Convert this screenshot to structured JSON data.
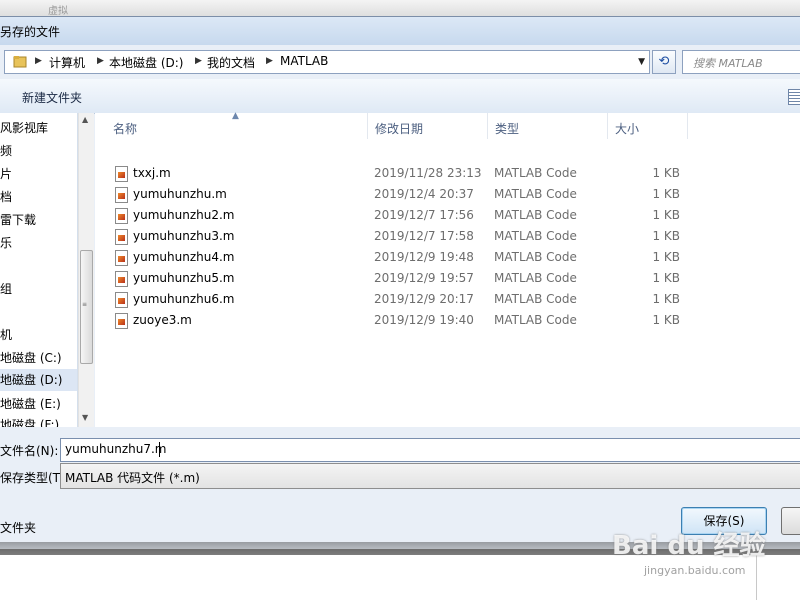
{
  "background": {
    "ghost_tab": "虚拟"
  },
  "dialog": {
    "title": "另存的文件",
    "address": {
      "crumbs": [
        "计算机",
        "本地磁盘 (D:)",
        "我的文档",
        "MATLAB"
      ]
    },
    "search_placeholder": "搜索 MATLAB",
    "toolbar": {
      "new_folder": "新建文件夹"
    },
    "nav": {
      "items": [
        "风影视库",
        "频",
        "片",
        "档",
        "雷下载",
        "乐",
        "组",
        "机",
        "地磁盘 (C:)",
        "地磁盘 (D:)",
        "地磁盘 (E:)",
        "地磁盘 (F:)"
      ],
      "selected_index": 9
    },
    "columns": {
      "name": "名称",
      "date": "修改日期",
      "type": "类型",
      "size": "大小"
    },
    "files": [
      {
        "name": "txxj.m",
        "date": "2019/11/28 23:13",
        "type": "MATLAB Code",
        "size": "1 KB"
      },
      {
        "name": "yumuhunzhu.m",
        "date": "2019/12/4 20:37",
        "type": "MATLAB Code",
        "size": "1 KB"
      },
      {
        "name": "yumuhunzhu2.m",
        "date": "2019/12/7 17:56",
        "type": "MATLAB Code",
        "size": "1 KB"
      },
      {
        "name": "yumuhunzhu3.m",
        "date": "2019/12/7 17:58",
        "type": "MATLAB Code",
        "size": "1 KB"
      },
      {
        "name": "yumuhunzhu4.m",
        "date": "2019/12/9 19:48",
        "type": "MATLAB Code",
        "size": "1 KB"
      },
      {
        "name": "yumuhunzhu5.m",
        "date": "2019/12/9 19:57",
        "type": "MATLAB Code",
        "size": "1 KB"
      },
      {
        "name": "yumuhunzhu6.m",
        "date": "2019/12/9 20:17",
        "type": "MATLAB Code",
        "size": "1 KB"
      },
      {
        "name": "zuoye3.m",
        "date": "2019/12/9 19:40",
        "type": "MATLAB Code",
        "size": "1 KB"
      }
    ],
    "filename_label": "文件名(N):",
    "filename_value": "yumuhunzhu7.m",
    "filetype_label": "保存类型(T):",
    "filetype_value": "MATLAB 代码文件 (*.m)",
    "hide_folders": "文件夹",
    "save_button": "保存(S)"
  },
  "watermark": {
    "main": "Bai du 经验",
    "sub": "jingyan.baidu.com"
  }
}
